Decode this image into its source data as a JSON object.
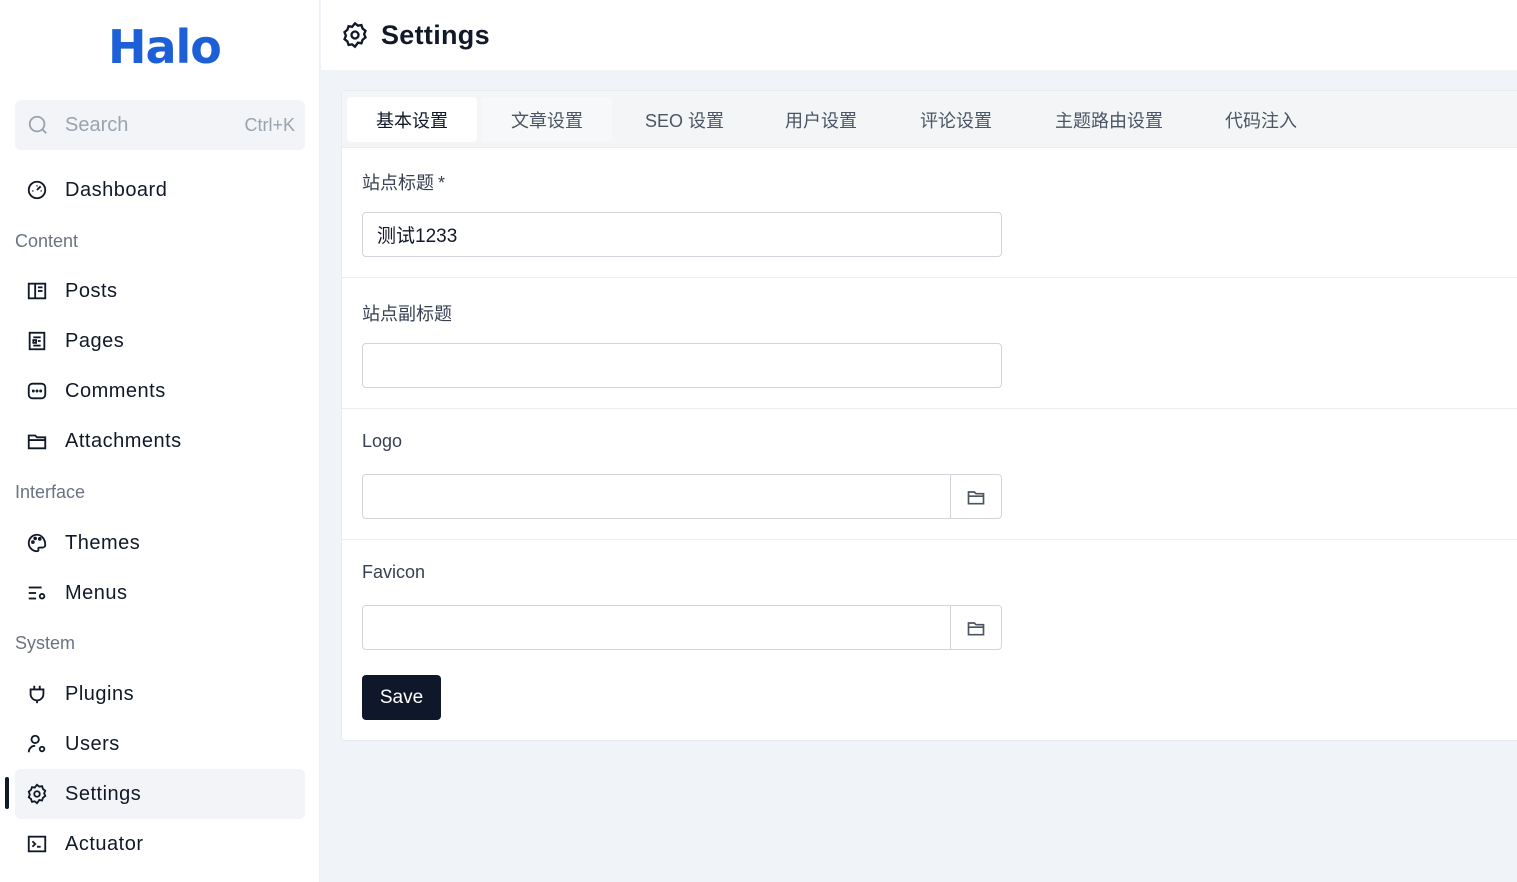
{
  "brand": {
    "logo_text": "Halo",
    "accent": "#1d5fd6"
  },
  "search": {
    "placeholder": "Search",
    "shortcut": "Ctrl+K"
  },
  "sidebar": {
    "dashboard": "Dashboard",
    "sections": {
      "content": "Content",
      "interface": "Interface",
      "system": "System"
    },
    "items": {
      "posts": "Posts",
      "pages": "Pages",
      "comments": "Comments",
      "attachments": "Attachments",
      "themes": "Themes",
      "menus": "Menus",
      "plugins": "Plugins",
      "users": "Users",
      "settings": "Settings",
      "actuator": "Actuator"
    },
    "active": "settings"
  },
  "header": {
    "title": "Settings",
    "icon": "gear-icon"
  },
  "tabs": [
    "基本设置",
    "文章设置",
    "SEO 设置",
    "用户设置",
    "评论设置",
    "主题路由设置",
    "代码注入"
  ],
  "active_tab": "基本设置",
  "form": {
    "site_title": {
      "label": "站点标题",
      "required_mark": "*",
      "value": "测试1233"
    },
    "site_subtitle": {
      "label": "站点副标题",
      "value": ""
    },
    "logo": {
      "label": "Logo",
      "value": ""
    },
    "favicon": {
      "label": "Favicon",
      "value": ""
    },
    "save_label": "Save"
  },
  "colors": {
    "save_button": "#0f172a",
    "page_bg": "#f0f4f8"
  }
}
